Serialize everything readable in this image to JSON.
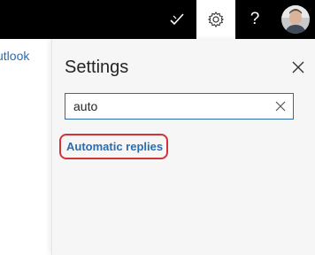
{
  "left_pane": {
    "link_text": "utlook"
  },
  "topbar": {
    "help_glyph": "?",
    "icons": [
      "checkmark-icon",
      "gear-icon",
      "help-icon",
      "avatar"
    ]
  },
  "settings": {
    "title": "Settings",
    "search": {
      "value": "auto",
      "placeholder": ""
    },
    "results": [
      {
        "label": "Automatic replies"
      }
    ]
  },
  "colors": {
    "topbar_bg": "#000000",
    "panel_bg": "#f6f6f6",
    "link": "#2b6cb0",
    "highlight": "#d13438"
  }
}
